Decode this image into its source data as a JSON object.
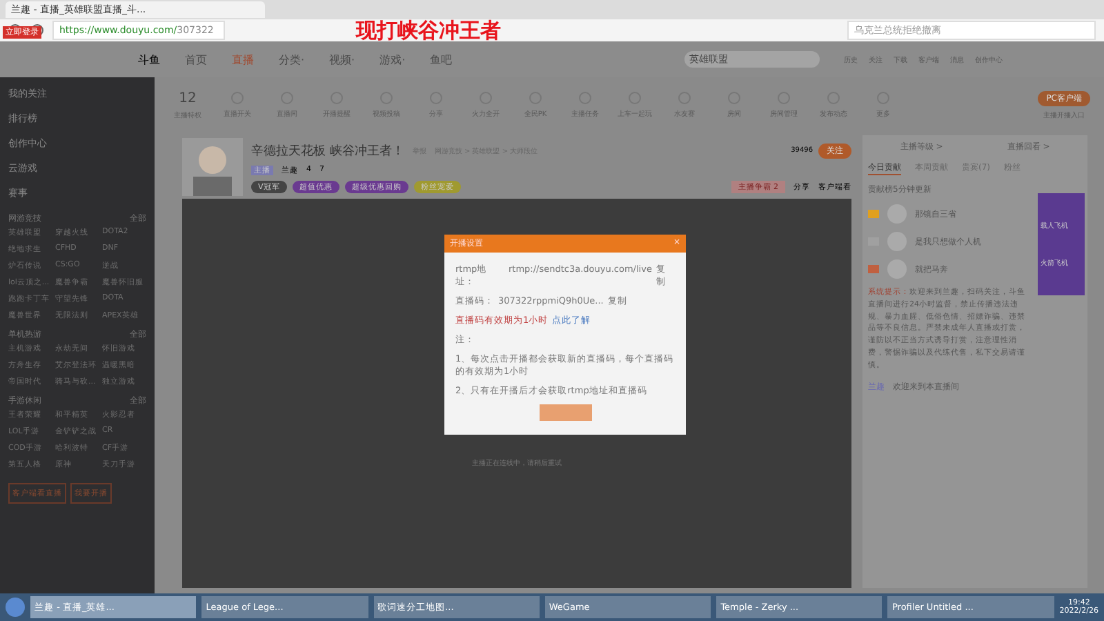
{
  "browser": {
    "login_badge": "立即登录",
    "tab_title": "兰趣 - 直播_英雄联盟直播_斗...",
    "url_host": "https://www.douyu.com/",
    "url_path": "307322",
    "search_placeholder": "乌克兰总统拒绝撤离"
  },
  "overlay_title": "现打峡谷冲王者",
  "nav": {
    "logo": "斗鱼",
    "items": [
      {
        "label": "首页",
        "selected": false
      },
      {
        "label": "直播",
        "selected": true
      },
      {
        "label": "分类·",
        "selected": false
      },
      {
        "label": "视频·",
        "selected": false
      },
      {
        "label": "游戏·",
        "selected": false
      },
      {
        "label": "鱼吧",
        "selected": false
      }
    ],
    "search_placeholder": "英雄联盟",
    "icons": [
      "历史",
      "关注",
      "下载",
      "客户端",
      "消息",
      "创作中心"
    ]
  },
  "sidebar": {
    "items": [
      "我的关注",
      "排行榜",
      "创作中心",
      "云游戏",
      "赛事"
    ],
    "sections": [
      {
        "title": "网游竞技",
        "more": "全部",
        "games": [
          "英雄联盟",
          "穿越火线",
          "DOTA2",
          "绝地求生",
          "CFHD",
          "DNF",
          "炉石传说",
          "CS:GO",
          "逆战",
          "lol云顶之...",
          "魔兽争霸",
          "魔兽怀旧服",
          "跑跑卡丁车",
          "守望先锋",
          "DOTA",
          "魔兽世界",
          "无限法则",
          "APEX英雄"
        ]
      },
      {
        "title": "单机热游",
        "more": "全部",
        "games": [
          "主机游戏",
          "永劫无间",
          "怀旧游戏",
          "方舟生存",
          "艾尔登法环",
          "温暖黑暗",
          "帝国时代",
          "骑马与砍...",
          "独立游戏"
        ]
      },
      {
        "title": "手游休闲",
        "more": "全部",
        "games": [
          "王者荣耀",
          "和平精英",
          "火影忍者",
          "LOL手游",
          "金铲铲之战",
          "CR",
          "COD手游",
          "哈利波特",
          "CF手游",
          "第五人格",
          "原神",
          "天刀手游"
        ]
      }
    ],
    "buttons": [
      "客户端看直播",
      "我要开播"
    ]
  },
  "tools": {
    "count": "12",
    "count_label": "主播特权",
    "items": [
      "直播开关",
      "直播间",
      "开播提醒",
      "视频投稿",
      "分享",
      "火力全开",
      "全民PK",
      "主播任务",
      "上车一起玩",
      "水友赛",
      "房间",
      "房间管理",
      "发布动态",
      "更多"
    ],
    "client_button": "PC客户端",
    "client_note": "主播开播入口"
  },
  "room": {
    "title": "辛德拉天花板 峡谷冲王者！",
    "report": "举报",
    "path": "网游竞技 > 英雄联盟 > 大师段位",
    "tag": "主播",
    "name": "兰趣",
    "heat": "4",
    "rank": "7",
    "badges": [
      "V冠军",
      "超值优惠",
      "超级优惠回购",
      "粉丝宠爱"
    ],
    "follow_count": "39496",
    "follow": "关注",
    "event": "主播争霸",
    "event_num": "2",
    "share": "分享",
    "client_watch": "客户端看"
  },
  "video_message": "主播正在连线中，请稍后重试",
  "dialog": {
    "title": "开播设置",
    "close": "×",
    "rtmp_label": "rtmp地址：",
    "rtmp_value": "rtmp://sendtc3a.douyu.com/live",
    "code_label": "直播码：",
    "code_value": "307322rppmiQ9h0Ue...",
    "copy": [
      "复制",
      "复制"
    ],
    "warning": "直播码有效期为1小时",
    "warning_link": "点此了解",
    "notes": [
      "注：",
      "1、每次点击开播都会获取新的直播码，每个直播码的有效期为1小时",
      "2、只有在开播后才会获取rtmp地址和直播码"
    ]
  },
  "right": {
    "links": [
      "主播等级 >",
      "直播回看 >"
    ],
    "tabs": [
      {
        "label": "今日贡献",
        "selected": true
      },
      {
        "label": "本周贡献",
        "selected": false
      },
      {
        "label": "贵宾(7)",
        "selected": false
      },
      {
        "label": "粉丝",
        "selected": false
      }
    ],
    "rank_note": "贡献榜5分钟更新",
    "ranks": [
      {
        "name": "那镜自三省",
        "color": "#e0a020"
      },
      {
        "name": "是我只想做个人机",
        "color": "#a0a0a0"
      },
      {
        "name": "就把马奔",
        "color": "#c06040"
      }
    ],
    "notice_label": "系统提示：",
    "notice": "欢迎来到兰趣，扫码关注，斗鱼直播间进行24小时监督，禁止传播违法违规、暴力血腥、低俗色情、招嫖诈骗、违禁品等不良信息。严禁未成年人直播或打赏，谨防以不正当方式诱导打赏，注意理性消费，警惕诈骗以及代练代售，私下交易请谨慎。",
    "chat_user": "兰趣",
    "chat_text": "欢迎来到本直播间",
    "ad": [
      "载人飞机",
      "火箭飞机"
    ]
  },
  "taskbar": {
    "apps": [
      {
        "label": "兰趣 - 直播_英雄...",
        "selected": true
      },
      {
        "label": "League of Lege...",
        "selected": false
      },
      {
        "label": "歌词速分工地图...",
        "selected": false
      },
      {
        "label": "WeGame",
        "selected": false
      },
      {
        "label": "Temple - Zerky ...",
        "selected": false
      },
      {
        "label": "Profiler Untitled ...",
        "selected": false
      }
    ],
    "time": "19:42",
    "date": "2022/2/26"
  }
}
